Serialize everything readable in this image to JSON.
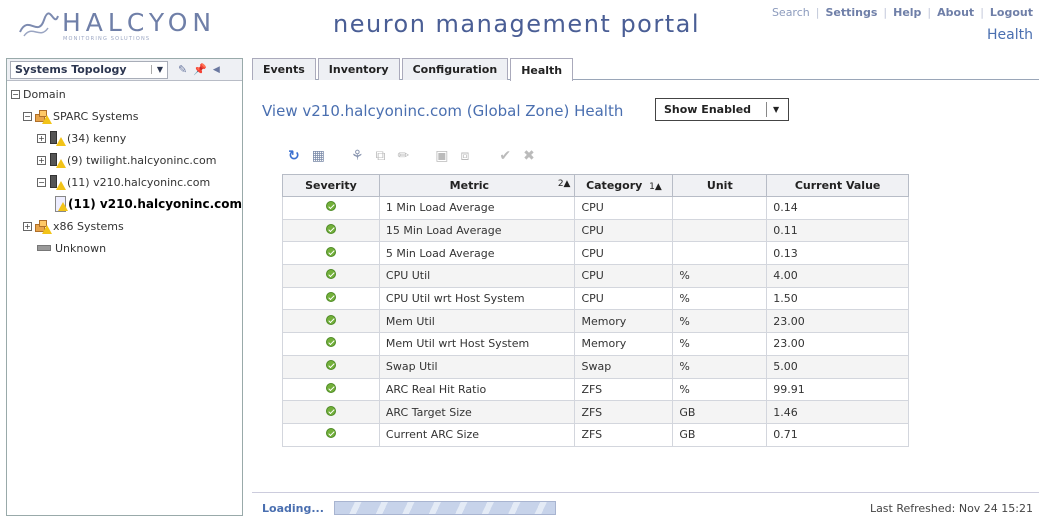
{
  "header": {
    "logo_text": "HALCYON",
    "logo_tagline": "MONITORING SOLUTIONS",
    "portal_title": "neuron management portal",
    "nav": [
      "Search",
      "Settings",
      "Help",
      "About",
      "Logout"
    ],
    "page_name": "Health"
  },
  "sidebar": {
    "title": "Systems Topology",
    "tree": {
      "domain": "Domain",
      "sparc": "SPARC Systems",
      "kenny": "(34) kenny",
      "twilight": "(9) twilight.halcyoninc.com",
      "v210": "(11) v210.halcyoninc.com",
      "v210_zone": "(11) v210.halcyoninc.com",
      "x86": "x86 Systems",
      "unknown": "Unknown"
    }
  },
  "tabs": [
    "Events",
    "Inventory",
    "Configuration",
    "Health"
  ],
  "active_tab": "Health",
  "main": {
    "view_title": "View v210.halcyoninc.com (Global Zone) Health",
    "show_select": "Show Enabled"
  },
  "table": {
    "columns": [
      "Severity",
      "Metric",
      "Category",
      "Unit",
      "Current Value"
    ],
    "metric_sort": "2▲",
    "category_sort": "1▲",
    "rows": [
      {
        "metric": "1 Min Load Average",
        "category": "CPU",
        "unit": "",
        "value": "0.14"
      },
      {
        "metric": "15 Min Load Average",
        "category": "CPU",
        "unit": "",
        "value": "0.11"
      },
      {
        "metric": "5 Min Load Average",
        "category": "CPU",
        "unit": "",
        "value": "0.13"
      },
      {
        "metric": "CPU Util",
        "category": "CPU",
        "unit": "%",
        "value": "4.00"
      },
      {
        "metric": "CPU Util wrt Host System",
        "category": "CPU",
        "unit": "%",
        "value": "1.50"
      },
      {
        "metric": "Mem Util",
        "category": "Memory",
        "unit": "%",
        "value": "23.00"
      },
      {
        "metric": "Mem Util wrt Host System",
        "category": "Memory",
        "unit": "%",
        "value": "23.00"
      },
      {
        "metric": "Swap Util",
        "category": "Swap",
        "unit": "%",
        "value": "5.00"
      },
      {
        "metric": "ARC Real Hit Ratio",
        "category": "ZFS",
        "unit": "%",
        "value": "99.91"
      },
      {
        "metric": "ARC Target Size",
        "category": "ZFS",
        "unit": "GB",
        "value": "1.46"
      },
      {
        "metric": "Current ARC Size",
        "category": "ZFS",
        "unit": "GB",
        "value": "0.71"
      }
    ]
  },
  "footer": {
    "loading": "Loading...",
    "last_refreshed": "Last Refreshed: Nov 24 15:21"
  },
  "colors": {
    "accent": "#4a6fb0",
    "ok": "#73b03a",
    "warning": "#f2c318"
  }
}
